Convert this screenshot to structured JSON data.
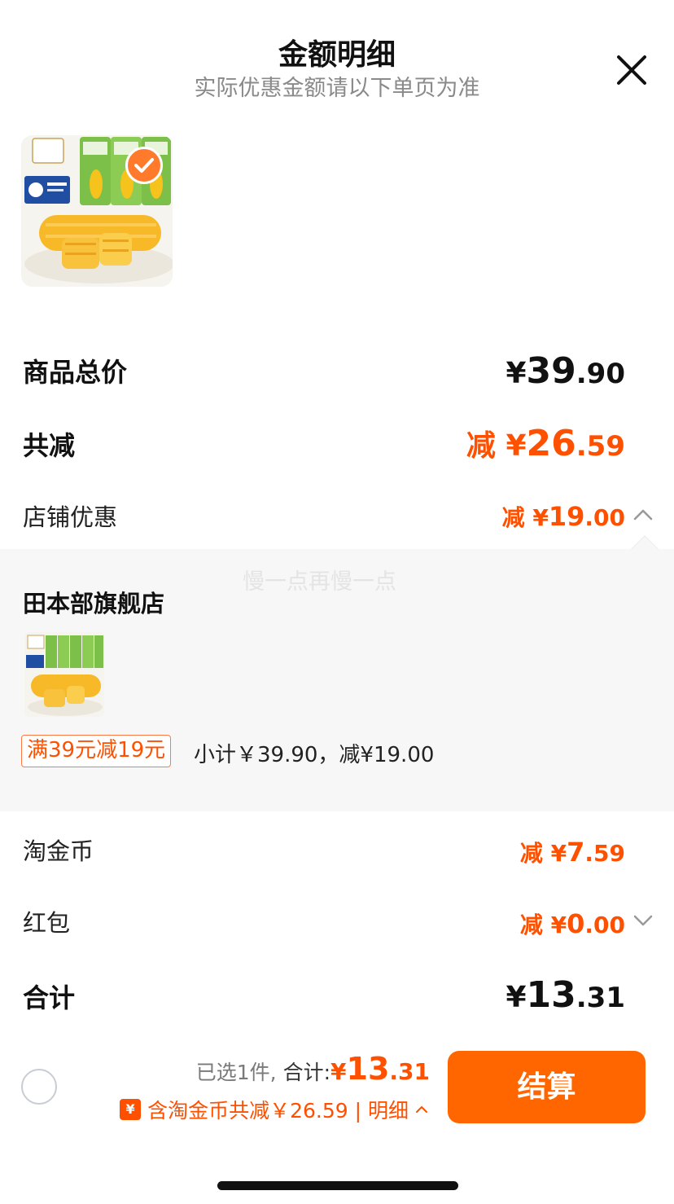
{
  "header": {
    "title": "金额明细",
    "subtitle": "实际优惠金额请以下单页为准",
    "close_icon": "close-icon"
  },
  "product": {
    "image": "corn-product-image",
    "selected": true,
    "check_icon": "checkmark-icon"
  },
  "summary": {
    "goods_total": {
      "label": "商品总价",
      "currency": "¥",
      "int": "39",
      "dec": ".90"
    },
    "total_discount": {
      "label": "共减",
      "prefix": "减 ",
      "currency": "¥",
      "int": "26",
      "dec": ".59"
    },
    "store_discount": {
      "label": "店铺优惠",
      "prefix": "减 ",
      "currency": "¥",
      "int": "19",
      "dec": ".00",
      "expanded": true
    }
  },
  "store_panel": {
    "watermark": "慢一点再慢一点",
    "shop_name": "田本部旗舰店",
    "promo_tag": "满39元减19元",
    "promo_detail": "小计￥39.90，减¥19.00"
  },
  "lines": {
    "coins": {
      "label": "淘金币",
      "prefix": "减 ",
      "currency": "¥",
      "int": "7",
      "dec": ".59"
    },
    "red_packet": {
      "label": "红包",
      "prefix": "减 ",
      "currency": "¥",
      "int": "0",
      "dec": ".00",
      "expanded": false
    },
    "total": {
      "label": "合计",
      "currency": "¥",
      "int": "13",
      "dec": ".31"
    }
  },
  "bottom_bar": {
    "selected_prefix": "已选1件,",
    "total_label": " 合计:",
    "currency": "¥",
    "total_int": "13",
    "total_dec": ".31",
    "coin_badge": "¥",
    "coin_text": "含淘金币共减￥26.59 | 明细",
    "checkout_label": "结算"
  },
  "colors": {
    "accent": "#ff5000",
    "button": "#ff6600",
    "panel_bg": "#f7f7f7",
    "muted_text": "#8a8a8a"
  }
}
